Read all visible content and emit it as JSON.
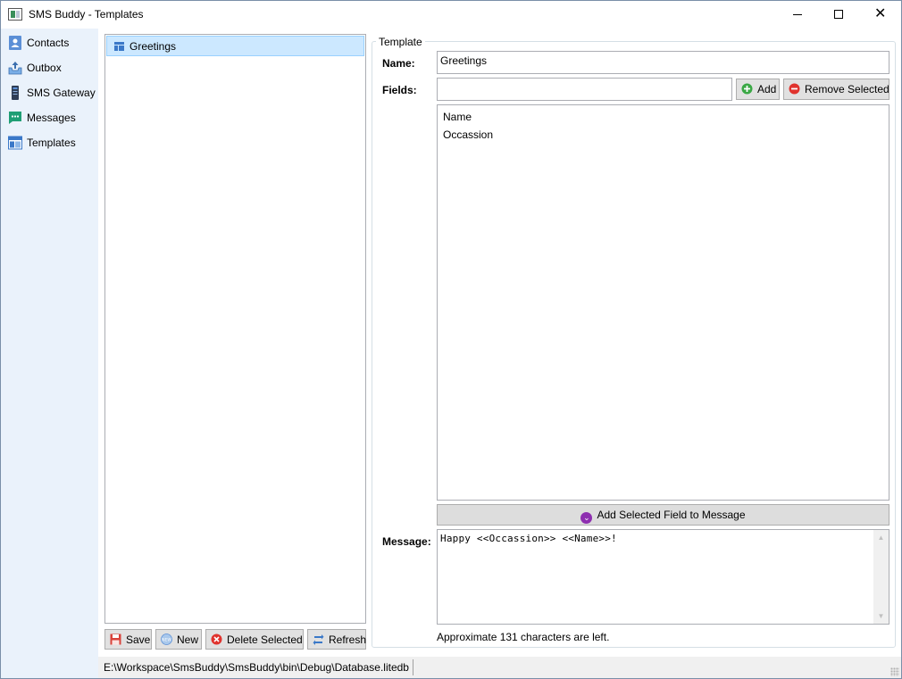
{
  "window": {
    "title": "SMS Buddy - Templates"
  },
  "nav": {
    "items": [
      {
        "label": "Contacts",
        "icon": "contacts-icon"
      },
      {
        "label": "Outbox",
        "icon": "outbox-icon"
      },
      {
        "label": "SMS Gateway",
        "icon": "gateway-icon"
      },
      {
        "label": "Messages",
        "icon": "messages-icon"
      },
      {
        "label": "Templates",
        "icon": "templates-icon"
      }
    ]
  },
  "templates_list": {
    "items": [
      {
        "label": "Greetings",
        "selected": true
      }
    ]
  },
  "list_toolbar": {
    "save_label": "Save",
    "new_label": "New",
    "delete_label": "Delete Selected",
    "refresh_label": "Refresh"
  },
  "template": {
    "group_title": "Template",
    "name_label": "Name:",
    "name_value": "Greetings",
    "fields_label": "Fields:",
    "field_input_value": "",
    "add_label": "Add",
    "remove_label": "Remove Selected",
    "fields": [
      "Name",
      "Occassion"
    ],
    "add_field_label": "Add Selected Field to Message",
    "message_label": "Message:",
    "message_value": "Happy <<Occassion>> <<Name>>!",
    "chars_left_text": "Approximate 131 characters are left."
  },
  "status": {
    "db_path": "E:\\Workspace\\SmsBuddy\\SmsBuddy\\bin\\Debug\\Database.litedb"
  },
  "colors": {
    "nav_bg": "#eaf2fb",
    "selection_bg": "#cce8ff",
    "accent_purple": "#8e2fb0",
    "add_green": "#3aa845",
    "remove_red": "#e0332e"
  }
}
